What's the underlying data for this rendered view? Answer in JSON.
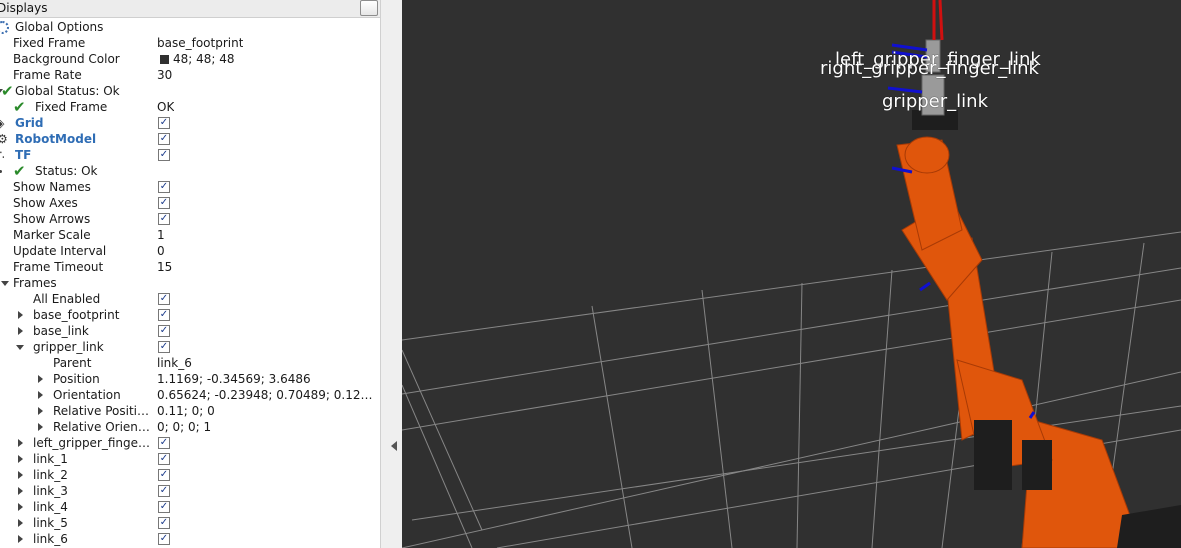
{
  "panel": {
    "title": "Displays",
    "rows": [
      {
        "name": "Global Options"
      },
      {
        "name": "Fixed Frame",
        "value": "base_footprint"
      },
      {
        "name": "Background Color",
        "value": "48; 48; 48"
      },
      {
        "name": "Frame Rate",
        "value": "30"
      },
      {
        "name": "Global Status: Ok"
      },
      {
        "name": "Fixed Frame",
        "value": "OK"
      },
      {
        "name": "Grid"
      },
      {
        "name": "RobotModel"
      },
      {
        "name": "TF"
      },
      {
        "name": "Status: Ok"
      },
      {
        "name": "Show Names"
      },
      {
        "name": "Show Axes"
      },
      {
        "name": "Show Arrows"
      },
      {
        "name": "Marker Scale",
        "value": "1"
      },
      {
        "name": "Update Interval",
        "value": "0"
      },
      {
        "name": "Frame Timeout",
        "value": "15"
      },
      {
        "name": "Frames"
      },
      {
        "name": "All Enabled"
      },
      {
        "name": "base_footprint"
      },
      {
        "name": "base_link"
      },
      {
        "name": "gripper_link"
      },
      {
        "name": "Parent",
        "value": "link_6"
      },
      {
        "name": "Position",
        "value": "1.1169; -0.34569; 3.6486"
      },
      {
        "name": "Orientation",
        "value": "0.65624; -0.23948; 0.70489; 0.12…"
      },
      {
        "name": "Relative Positi…",
        "value": "0.11; 0; 0"
      },
      {
        "name": "Relative Orien…",
        "value": "0; 0; 0; 1"
      },
      {
        "name": "left_gripper_finge…"
      },
      {
        "name": "link_1"
      },
      {
        "name": "link_2"
      },
      {
        "name": "link_3"
      },
      {
        "name": "link_4"
      },
      {
        "name": "link_5"
      },
      {
        "name": "link_6"
      }
    ]
  },
  "viewport": {
    "background_color": "#303030",
    "grid_color": "#a0a0a0",
    "robot_color": "#e0560c",
    "labels": {
      "left_gripper_finger_link": "left_gripper_finger_link",
      "right_gripper_finger_link": "right_gripper_finger_link",
      "gripper_link": "gripper_link"
    }
  },
  "icons": {
    "checkmark": "✓",
    "ok": "✔"
  }
}
